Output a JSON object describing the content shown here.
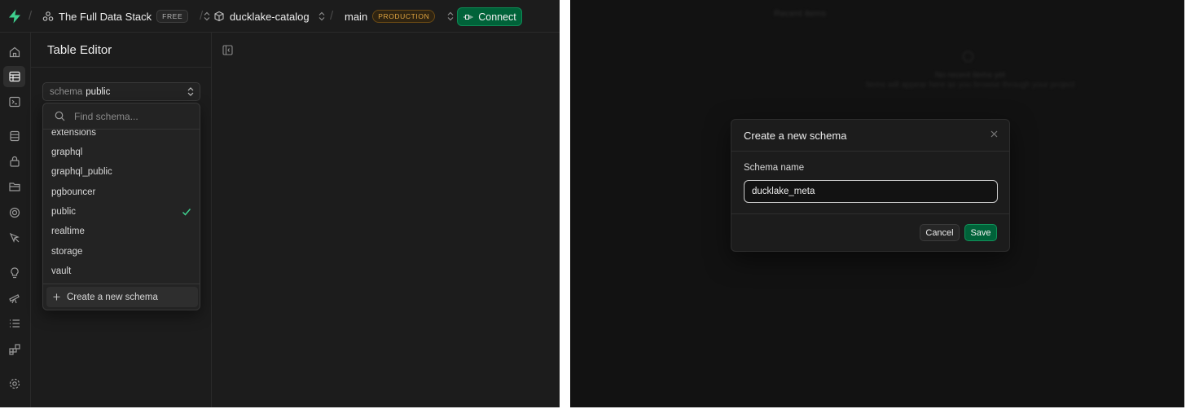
{
  "topbar": {
    "org_name": "The Full Data Stack",
    "plan_badge": "FREE",
    "project_name": "ducklake-catalog",
    "branch_name": "main",
    "env_badge": "PRODUCTION",
    "connect_label": "Connect"
  },
  "rail": {
    "icons": [
      "home-icon",
      "table-editor-icon",
      "sql-editor-icon",
      "database-icon",
      "auth-icon",
      "storage-icon",
      "realtime-icon",
      "edge-functions-icon",
      "advisors-icon",
      "reports-icon",
      "logs-icon",
      "integrations-icon",
      "settings-icon"
    ]
  },
  "sidebar": {
    "title": "Table Editor",
    "schema_select": {
      "label": "schema",
      "value": "public"
    },
    "dropdown": {
      "search_placeholder": "Find schema...",
      "items": [
        "extensions",
        "graphql",
        "graphql_public",
        "pgbouncer",
        "public",
        "realtime",
        "storage",
        "vault"
      ],
      "selected": "public",
      "create_label": "Create a new schema"
    }
  },
  "modal": {
    "title": "Create a new schema",
    "field_label": "Schema name",
    "field_value": "ducklake_meta",
    "cancel_label": "Cancel",
    "save_label": "Save"
  },
  "background": {
    "heading": "Recent items",
    "empty_title": "No recent items yet",
    "empty_subtitle": "Items will appear here as you browse through your project"
  },
  "colors": {
    "brand_green": "#3ecf8e",
    "button_green": "#006239",
    "production_badge": "#e0a440",
    "panel_bg": "#1c1c1c",
    "overlay_bg": "#121212"
  }
}
